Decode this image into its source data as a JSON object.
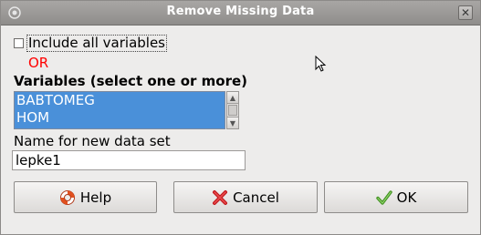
{
  "window": {
    "title": "Remove Missing Data",
    "close_glyph": "✕"
  },
  "include_all": {
    "label": "Include all variables",
    "checked": false
  },
  "or_text": "OR",
  "variables": {
    "label": "Variables (select one or more)",
    "items": [
      "BABTOMEG",
      "HOM"
    ],
    "selected": [
      "BABTOMEG",
      "HOM"
    ]
  },
  "new_dataset": {
    "label": "Name for new data set",
    "value": "lepke1"
  },
  "buttons": {
    "help_label": "Help",
    "cancel_label": "Cancel",
    "ok_label": "OK"
  },
  "icons": {
    "window": "r-window-icon",
    "help": "lifebuoy-icon",
    "cancel": "red-x-icon",
    "ok": "green-check-icon",
    "cursor": "mouse-pointer-icon"
  },
  "colors": {
    "or_text": "#ff0000",
    "selection": "#4a90d9",
    "titlebar": "#9a9896"
  }
}
